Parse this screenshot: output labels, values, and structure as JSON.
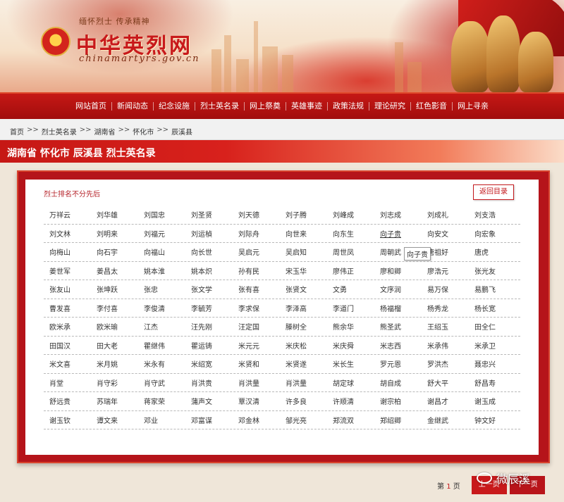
{
  "header": {
    "slogan": "缅怀烈士 传承精神",
    "site_title": "中华英烈网",
    "site_url": "chinamartyrs.gov.cn"
  },
  "nav": {
    "items": [
      "网站首页",
      "新闻动态",
      "纪念设施",
      "烈士英名录",
      "网上祭奠",
      "英雄事迹",
      "政策法规",
      "理论研究",
      "红色影音",
      "网上寻亲"
    ]
  },
  "breadcrumb": {
    "items": [
      "首页",
      "烈士英名录",
      "湖南省",
      "怀化市",
      "辰溪县"
    ],
    "separator": ">>"
  },
  "section": {
    "title": "湖南省 怀化市 辰溪县 烈士英名录"
  },
  "list": {
    "note": "烈士排名不分先后",
    "back_label": "返回目录",
    "names": [
      [
        "万祥云",
        "刘华雄",
        "刘国忠",
        "刘圣贤",
        "刘天德",
        "刘子腾",
        "刘峰成",
        "刘志成",
        "刘成礼",
        "刘支浩"
      ],
      [
        "刘文林",
        "刘明来",
        "刘福元",
        "刘运楨",
        "刘际舟",
        "向世来",
        "向东生",
        "向子贵",
        "向安文",
        "向宏象"
      ],
      [
        "向梅山",
        "向石宇",
        "向福山",
        "向长世",
        "吴启元",
        "吴启知",
        "周世凤",
        "周朝武",
        "唐祖好",
        "唐虎"
      ],
      [
        "姜世军",
        "姜昌太",
        "姚本淮",
        "姚本炽",
        "孙有民",
        "宋玉华",
        "廖伟正",
        "廖和卿",
        "廖浩元",
        "张光友"
      ],
      [
        "张友山",
        "张坤跃",
        "张忠",
        "张文学",
        "张有喜",
        "张贤文",
        "文勇",
        "文序润",
        "易万保",
        "易鹏飞"
      ],
      [
        "曹发喜",
        "李付喜",
        "李俊清",
        "李毓芳",
        "李求保",
        "李泽高",
        "李道门",
        "杨福榴",
        "杨秀龙",
        "杨长宽"
      ],
      [
        "欧米承",
        "欧米瑜",
        "江杰",
        "汪先刚",
        "汪定国",
        "滕树全",
        "熊余华",
        "熊圣武",
        "王绍玉",
        "田全仁"
      ],
      [
        "田国汉",
        "田大老",
        "瞿继伟",
        "瞿运铸",
        "米元元",
        "米庆松",
        "米庆舜",
        "米志西",
        "米承伟",
        "米承卫"
      ],
      [
        "米文喜",
        "米月姚",
        "米永有",
        "米绍宽",
        "米贤和",
        "米贤遂",
        "米长生",
        "罗元恩",
        "罗洪杰",
        "聂忠兴"
      ],
      [
        "肖堂",
        "肖守彩",
        "肖守武",
        "肖洪贵",
        "肖洪量",
        "肖洪量",
        "胡定球",
        "胡自成",
        "舒大平",
        "舒昌寿"
      ],
      [
        "舒远贵",
        "苏瑞年",
        "蒋家荣",
        "蒲声文",
        "覃汉清",
        "许多良",
        "许顺清",
        "谢宗柏",
        "谢昌才",
        "谢玉成"
      ],
      [
        "谢玉钦",
        "谭文来",
        "邓业",
        "邓富谋",
        "邓金林",
        "邹光亮",
        "郑流双",
        "郑绍卿",
        "金继武",
        "钟文好"
      ]
    ],
    "underlined_name": "向子贵",
    "tooltip": "向子贵"
  },
  "pager": {
    "prefix": "第",
    "current": "1",
    "suffix": "页",
    "prev_label": "上一页",
    "next_label": "下一页"
  },
  "watermark": {
    "text": "微辰溪"
  }
}
